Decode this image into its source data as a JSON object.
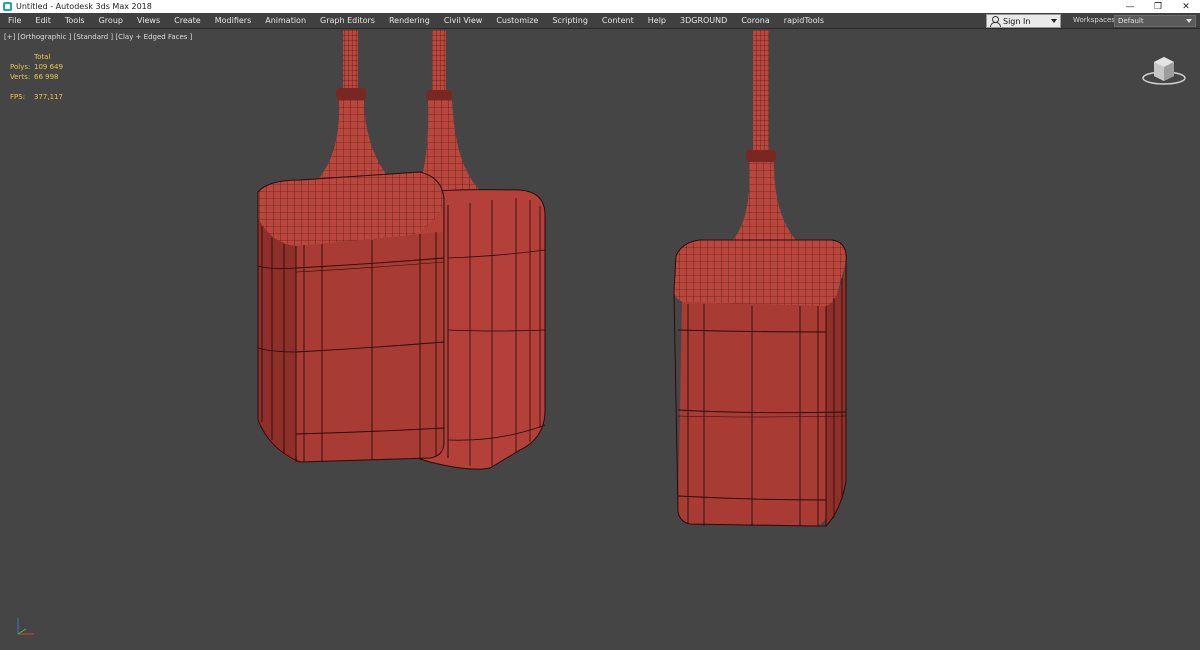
{
  "window": {
    "title": "Untitled - Autodesk 3ds Max 2018",
    "controls": {
      "minimize": "—",
      "restore": "❐",
      "close": "✕"
    }
  },
  "menu": {
    "items": [
      "File",
      "Edit",
      "Tools",
      "Group",
      "Views",
      "Create",
      "Modifiers",
      "Animation",
      "Graph Editors",
      "Rendering",
      "Civil View",
      "Customize",
      "Scripting",
      "Content",
      "Help",
      "3DGROUND",
      "Corona",
      "rapidTools"
    ],
    "sign_in": "Sign In",
    "workspaces_label": "Workspaces:",
    "workspaces_value": "Default"
  },
  "viewport": {
    "labels": "[+] [Orthographic ] [Standard ] [Clay + Edged Faces ]",
    "stats": {
      "header": "Total",
      "polys_label": "Polys:",
      "polys_value": "109 649",
      "verts_label": "Verts:",
      "verts_value": "66 998",
      "fps_label": "FPS:",
      "fps_value": "377,117"
    }
  },
  "colors": {
    "viewport_bg": "#454545",
    "clay": "#b9473d",
    "clay_dark": "#8a2f28",
    "wire": "#2a0c0a",
    "stats_text": "#e5c84a"
  },
  "icons": {
    "viewcube": "viewcube-icon",
    "axis": "axis-tripod-icon",
    "user": "user-icon"
  }
}
